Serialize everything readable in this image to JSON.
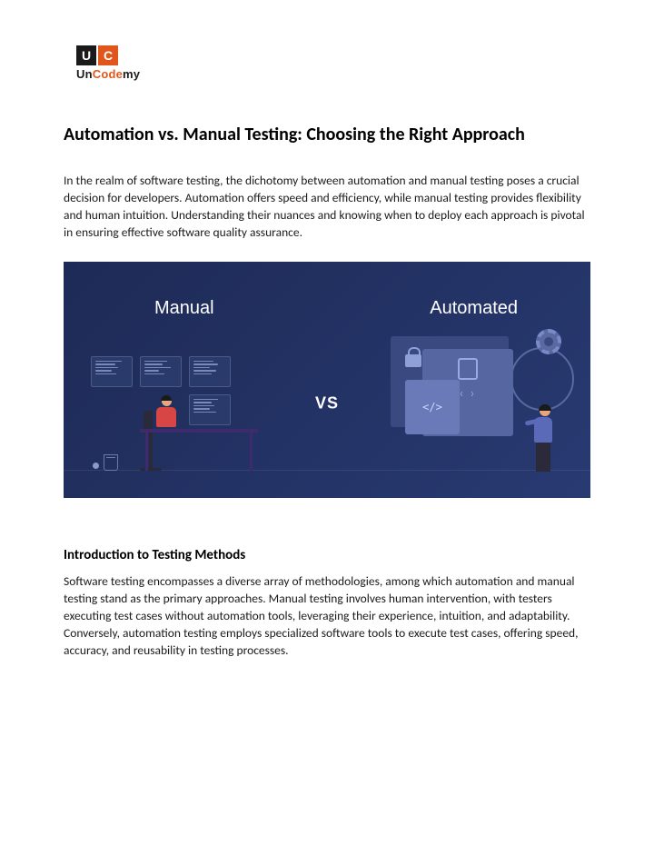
{
  "logo": {
    "tile_u": "U",
    "tile_c": "C",
    "part_un": "Un",
    "part_code": "Code",
    "part_my": "my"
  },
  "title": "Automation vs. Manual Testing: Choosing the Right Approach",
  "intro_paragraph": "In the realm of software testing, the dichotomy between automation and manual testing poses a crucial decision for developers. Automation offers speed and efficiency, while manual testing provides flexibility and human intuition. Understanding their nuances and knowing when to deploy each approach is pivotal in ensuring effective software quality assurance.",
  "hero": {
    "left_label": "Manual",
    "right_label": "Automated",
    "vs": "VS"
  },
  "section1": {
    "heading": "Introduction to Testing Methods",
    "body": "Software testing encompasses a diverse array of methodologies, among which automation and manual testing stand as the primary approaches. Manual testing involves human intervention, with testers executing test cases without automation tools, leveraging their experience, intuition, and adaptability. Conversely, automation testing employs specialized software tools to execute test cases, offering speed, accuracy, and reusability in testing processes."
  },
  "colors": {
    "brand_orange": "#e1571b",
    "hero_bg_start": "#1e2a56",
    "hero_bg_end": "#283a72"
  }
}
